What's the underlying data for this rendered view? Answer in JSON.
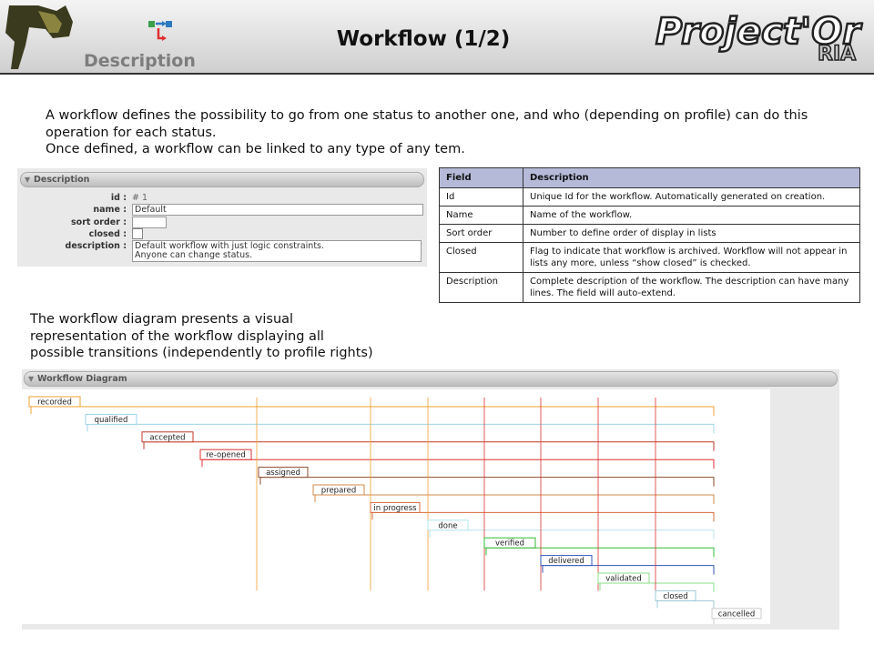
{
  "header": {
    "section": "Description",
    "title": "Workflow (1/2)",
    "brand": "Project'Or",
    "brand_suffix": "RIA"
  },
  "intro": {
    "line1": "A workflow defines the possibility to go from one status to another one, and who (depending on profile) can do this operation for each status.",
    "line2": "Once defined, a workflow can be linked to any type of any tem."
  },
  "form": {
    "panel_title": "Description",
    "id_label": "id :",
    "id_value": "# 1",
    "name_label": "name :",
    "name_value": "Default",
    "sort_label": "sort order :",
    "sort_value": "",
    "closed_label": "closed :",
    "closed_checked": false,
    "desc_label": "description :",
    "desc_line1": "Default workflow with just logic constraints.",
    "desc_line2": "Anyone can change status."
  },
  "table": {
    "headers": [
      "Field",
      "Description"
    ],
    "rows": [
      [
        "Id",
        "Unique Id for the workflow. Automatically generated on creation."
      ],
      [
        "Name",
        "Name of the workflow."
      ],
      [
        "Sort order",
        "Number to define order of display in lists"
      ],
      [
        "Closed",
        "Flag to indicate that workflow is archived. Workflow will not appear in lists any more, unless “show closed” is checked."
      ],
      [
        "Description",
        "Complete description of the workflow. The description can have many lines. The field will auto-extend."
      ]
    ]
  },
  "diagram_text": {
    "line1": "The workflow diagram presents a visual",
    "line2": "representation of the workflow displaying all",
    "line3": "possible transitions (independently to profile rights)"
  },
  "workflow": {
    "panel_title": "Workflow Diagram",
    "statuses": [
      {
        "name": "recorded",
        "color": "#f0a030"
      },
      {
        "name": "qualified",
        "color": "#9fd4e8"
      },
      {
        "name": "accepted",
        "color": "#c0392b"
      },
      {
        "name": "re-opened",
        "color": "#e03030"
      },
      {
        "name": "assigned",
        "color": "#8b4a2b"
      },
      {
        "name": "prepared",
        "color": "#d2884a"
      },
      {
        "name": "in progress",
        "color": "#d86a3a"
      },
      {
        "name": "done",
        "color": "#b6e4ee"
      },
      {
        "name": "verified",
        "color": "#33bb33"
      },
      {
        "name": "delivered",
        "color": "#3355bb"
      },
      {
        "name": "validated",
        "color": "#88dd88"
      },
      {
        "name": "closed",
        "color": "#9ec8d8"
      },
      {
        "name": "cancelled",
        "color": "#cccccc"
      }
    ]
  }
}
